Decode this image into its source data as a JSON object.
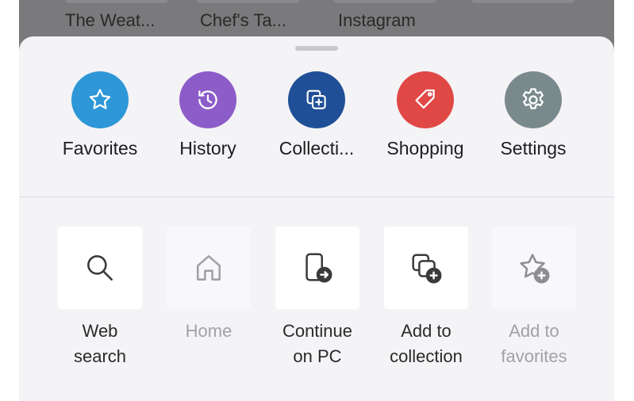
{
  "background_tabs": [
    {
      "label": "The Weat..."
    },
    {
      "label": "Chef's Ta..."
    },
    {
      "label": "Instagram"
    }
  ],
  "quick_links": [
    {
      "label": "Favorites",
      "icon": "star-icon",
      "color": "#2e97d8"
    },
    {
      "label": "History",
      "icon": "history-icon",
      "color": "#8c5cc8"
    },
    {
      "label": "Collecti...",
      "icon": "collections-icon",
      "color": "#1f4f96"
    },
    {
      "label": "Shopping",
      "icon": "tag-icon",
      "color": "#e04845"
    },
    {
      "label": "Settings",
      "icon": "gear-icon",
      "color": "#7a8a8c"
    }
  ],
  "actions": [
    {
      "line1": "Web",
      "line2": "search",
      "icon": "search-icon",
      "enabled": true
    },
    {
      "line1": "Home",
      "line2": "",
      "icon": "home-icon",
      "enabled": false
    },
    {
      "line1": "Continue",
      "line2": "on PC",
      "icon": "continue-on-pc-icon",
      "enabled": true
    },
    {
      "line1": "Add to",
      "line2": "collection",
      "icon": "add-to-collection-icon",
      "enabled": true
    },
    {
      "line1": "Add to",
      "line2": "favorites",
      "icon": "add-to-favorites-icon",
      "enabled": false
    }
  ]
}
